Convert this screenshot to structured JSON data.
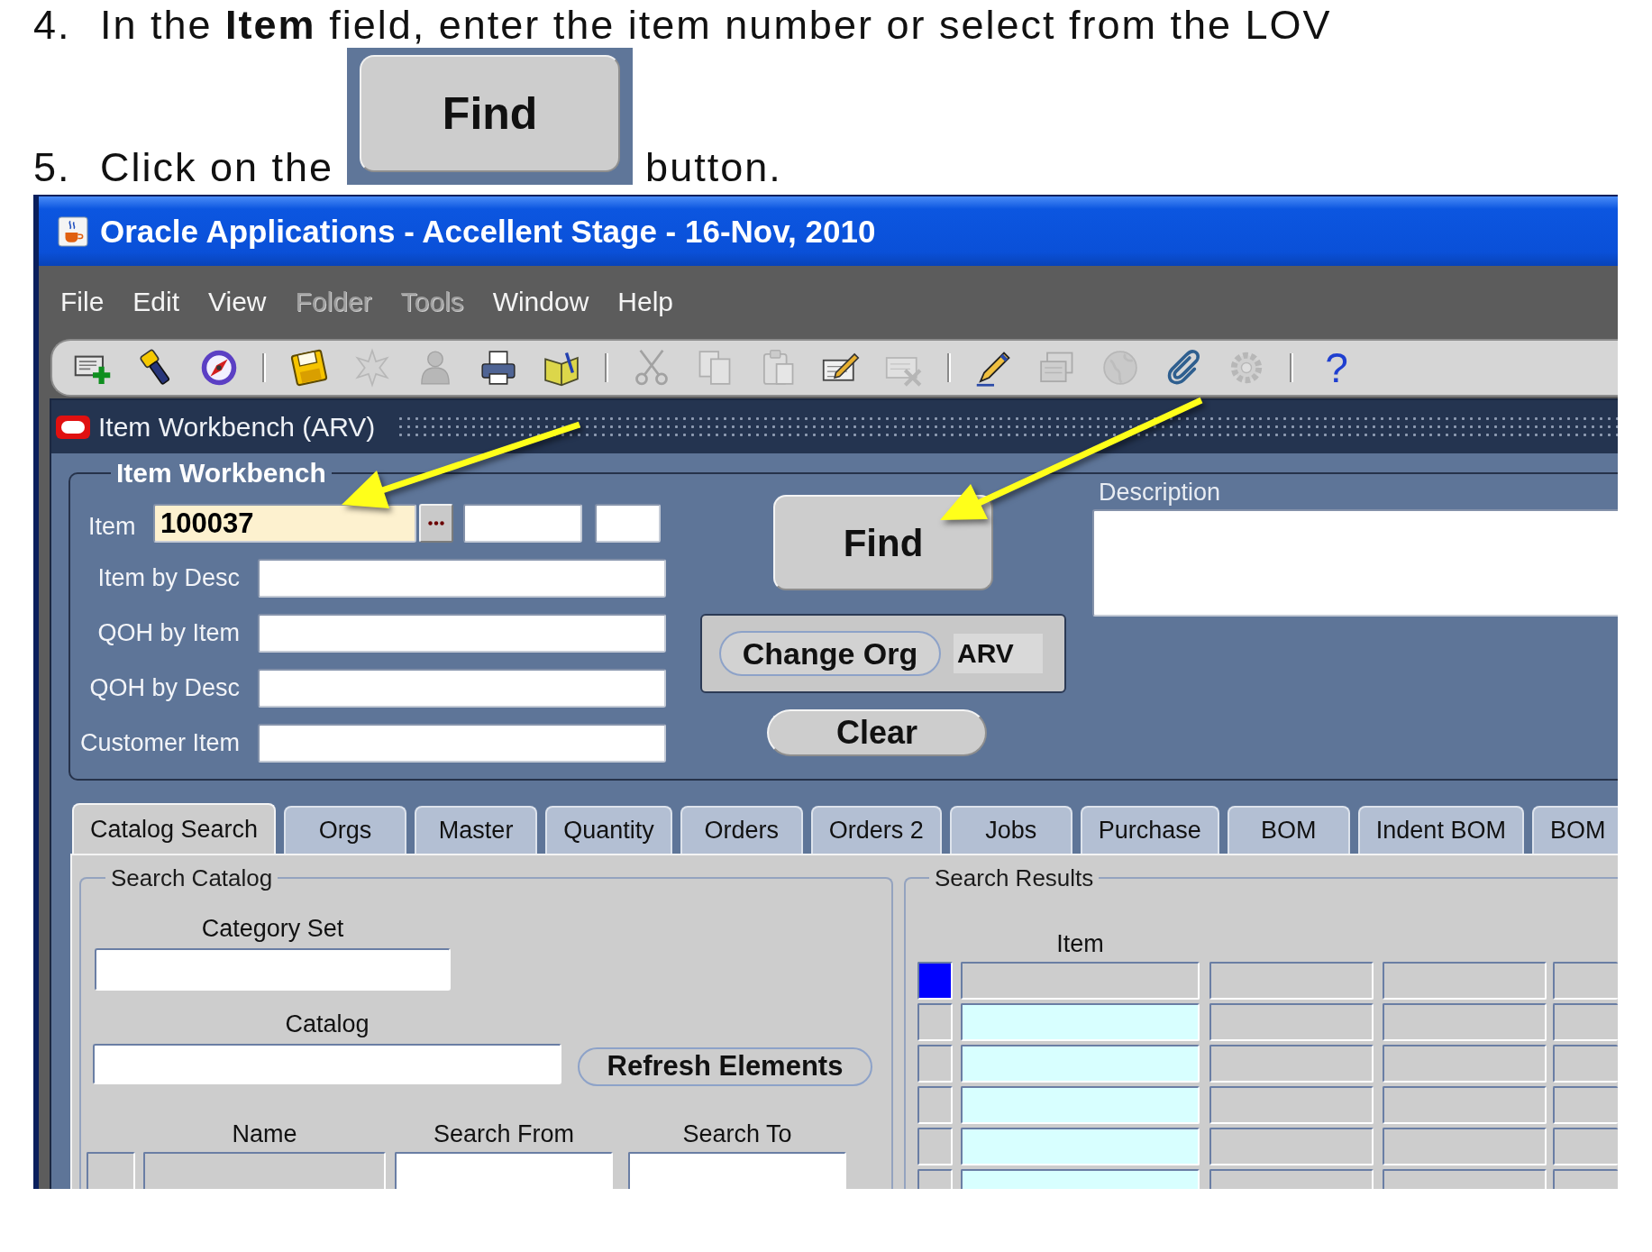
{
  "instructions": [
    {
      "kind": "text",
      "number": "4.",
      "text": "In the **Item** field, enter the item number or select from the LOV"
    },
    {
      "kind": "button_image",
      "number": "5.",
      "before": "Click on the",
      "button": "Find",
      "after": "button."
    }
  ],
  "window": {
    "title": "Oracle Applications - Accellent Stage - 16-Nov, 2010",
    "menu": [
      {
        "label": "File",
        "disabled": false
      },
      {
        "label": "Edit",
        "disabled": false
      },
      {
        "label": "View",
        "disabled": false
      },
      {
        "label": "Folder",
        "disabled": true
      },
      {
        "label": "Tools",
        "disabled": true
      },
      {
        "label": "Window",
        "disabled": false
      },
      {
        "label": "Help",
        "disabled": false
      }
    ],
    "toolbar": [
      {
        "kind": "icon",
        "disabled": false
      },
      {
        "kind": "icon",
        "disabled": false
      },
      {
        "kind": "icon",
        "disabled": false
      },
      {
        "kind": "separator"
      },
      {
        "kind": "icon",
        "disabled": false
      },
      {
        "kind": "icon",
        "disabled": true
      },
      {
        "kind": "icon",
        "disabled": true
      },
      {
        "kind": "icon",
        "disabled": false
      },
      {
        "kind": "icon",
        "disabled": false
      },
      {
        "kind": "separator"
      },
      {
        "kind": "icon",
        "disabled": true
      },
      {
        "kind": "icon",
        "disabled": true
      },
      {
        "kind": "icon",
        "disabled": true
      },
      {
        "kind": "icon",
        "disabled": false
      },
      {
        "kind": "icon",
        "disabled": true
      },
      {
        "kind": "separator"
      },
      {
        "kind": "icon",
        "disabled": false
      },
      {
        "kind": "icon",
        "disabled": true
      },
      {
        "kind": "icon",
        "disabled": true
      },
      {
        "kind": "icon",
        "disabled": false
      },
      {
        "kind": "icon",
        "disabled": true
      },
      {
        "kind": "separator"
      },
      {
        "kind": "glyph",
        "label": "?",
        "disabled": false
      }
    ]
  },
  "form": {
    "title": "Item Workbench (ARV)",
    "group_label": "Item Workbench",
    "fields": [
      {
        "kind": "lov",
        "label": "Item",
        "value": "100037",
        "focused": true
      },
      {
        "kind": "text",
        "label": "Item by Desc",
        "focused": false
      },
      {
        "kind": "text",
        "label": "QOH by Item",
        "focused": false
      },
      {
        "kind": "text",
        "label": "QOH by Desc",
        "focused": false
      },
      {
        "kind": "text",
        "label": "Customer Item",
        "focused": false
      }
    ],
    "find_button": "Find",
    "change_org": {
      "button": "Change Org",
      "org_code": "ARV"
    },
    "clear_button": "Clear",
    "description_label": "Description"
  },
  "tabs": [
    {
      "label": "Catalog Search",
      "selected": true
    },
    {
      "label": "Orgs",
      "selected": false
    },
    {
      "label": "Master",
      "selected": false
    },
    {
      "label": "Quantity",
      "selected": false
    },
    {
      "label": "Orders",
      "selected": false
    },
    {
      "label": "Orders 2",
      "selected": false
    },
    {
      "label": "Jobs",
      "selected": false
    },
    {
      "label": "Purchase",
      "selected": false
    },
    {
      "label": "BOM",
      "selected": false
    },
    {
      "label": "Indent BOM",
      "selected": false
    },
    {
      "label": "BOM",
      "selected": false
    }
  ],
  "search_catalog": {
    "label": "Search Catalog",
    "category_set_label": "Category Set",
    "catalog_label": "Catalog",
    "refresh_button": "Refresh Elements",
    "columns": [
      "Name",
      "Search From",
      "Search To"
    ]
  },
  "search_results": {
    "label": "Search Results",
    "item_column": "Item",
    "rows": [
      {
        "current": true
      },
      {
        "current": false
      },
      {
        "current": false
      },
      {
        "current": false
      },
      {
        "current": false
      },
      {
        "current": false
      }
    ]
  }
}
